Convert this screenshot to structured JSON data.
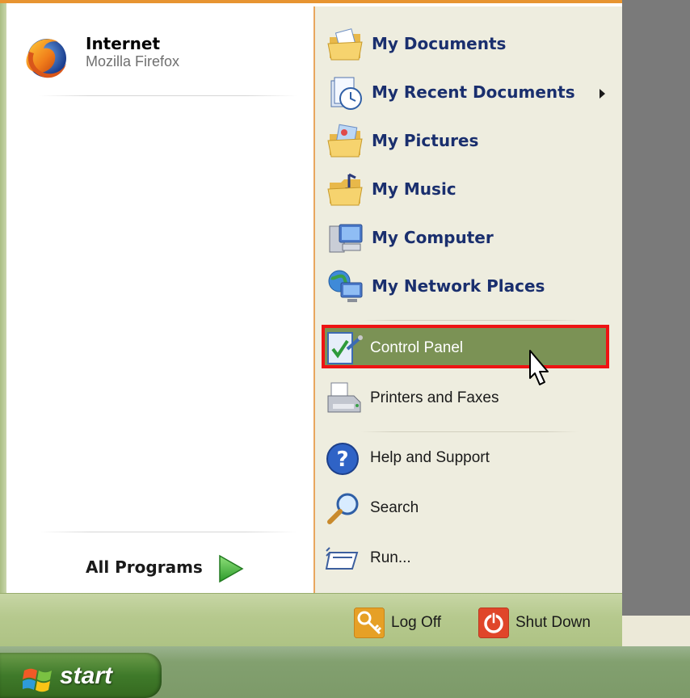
{
  "start_menu": {
    "pinned": {
      "title": "Internet",
      "subtitle": "Mozilla Firefox",
      "icon": "firefox-icon"
    },
    "all_programs_label": "All Programs",
    "right_items": [
      {
        "label": "My Documents",
        "icon": "my-documents-folder-icon",
        "style": "bold"
      },
      {
        "label": "My Recent Documents",
        "icon": "recent-documents-icon",
        "style": "bold",
        "has_submenu": true
      },
      {
        "label": "My Pictures",
        "icon": "my-pictures-folder-icon",
        "style": "bold"
      },
      {
        "label": "My Music",
        "icon": "my-music-folder-icon",
        "style": "bold"
      },
      {
        "label": "My Computer",
        "icon": "my-computer-icon",
        "style": "bold"
      },
      {
        "label": "My Network Places",
        "icon": "network-places-icon",
        "style": "bold"
      },
      {
        "label": "Control Panel",
        "icon": "control-panel-icon",
        "style": "regular",
        "highlighted": true
      },
      {
        "label": "Printers and Faxes",
        "icon": "printer-icon",
        "style": "regular"
      },
      {
        "label": "Help and Support",
        "icon": "help-icon",
        "style": "regular"
      },
      {
        "label": "Search",
        "icon": "search-icon",
        "style": "regular"
      },
      {
        "label": "Run...",
        "icon": "run-icon",
        "style": "regular"
      }
    ],
    "bottom": {
      "log_off_label": "Log Off",
      "shut_down_label": "Shut Down"
    }
  },
  "taskbar": {
    "start_label": "start"
  },
  "colors": {
    "highlight_fill": "#7b9255",
    "highlight_border": "#ee1313",
    "menu_top_border": "#e79431",
    "right_pane_bg": "#eeeddf",
    "bold_label": "#1a2f6e"
  }
}
